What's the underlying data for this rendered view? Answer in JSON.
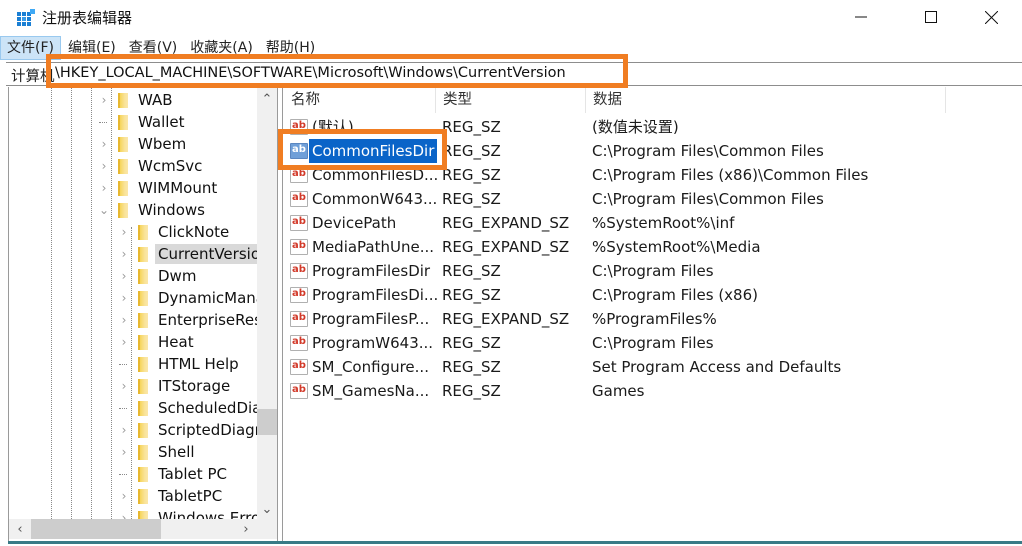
{
  "window": {
    "title": "注册表编辑器",
    "app_icon": "regedit-icon",
    "controls": {
      "minimize": "minimize-icon",
      "maximize": "maximize-icon",
      "close": "close-icon"
    }
  },
  "menu": {
    "items": [
      {
        "label": "文件(F)",
        "active": true
      },
      {
        "label": "编辑(E)",
        "active": false
      },
      {
        "label": "查看(V)",
        "active": false
      },
      {
        "label": "收藏夹(A)",
        "active": false
      },
      {
        "label": "帮助(H)",
        "active": false
      }
    ]
  },
  "address": {
    "prefix": "计算机",
    "path": "\\HKEY_LOCAL_MACHINE\\SOFTWARE\\Microsoft\\Windows\\CurrentVersion"
  },
  "annotation": {
    "color": "#f07d22"
  },
  "tree": {
    "items": [
      {
        "label": "WAB",
        "level": 0,
        "expander": "collapsed"
      },
      {
        "label": "Wallet",
        "level": 0,
        "expander": "none"
      },
      {
        "label": "Wbem",
        "level": 0,
        "expander": "collapsed"
      },
      {
        "label": "WcmSvc",
        "level": 0,
        "expander": "collapsed"
      },
      {
        "label": "WIMMount",
        "level": 0,
        "expander": "collapsed"
      },
      {
        "label": "Windows",
        "level": 0,
        "expander": "expanded"
      },
      {
        "label": "ClickNote",
        "level": 1,
        "expander": "collapsed"
      },
      {
        "label": "CurrentVersion",
        "level": 1,
        "expander": "collapsed",
        "selected": true
      },
      {
        "label": "Dwm",
        "level": 1,
        "expander": "collapsed"
      },
      {
        "label": "DynamicManagement",
        "level": 1,
        "expander": "collapsed"
      },
      {
        "label": "EnterpriseResourceManager",
        "level": 1,
        "expander": "collapsed"
      },
      {
        "label": "Heat",
        "level": 1,
        "expander": "collapsed"
      },
      {
        "label": "HTML Help",
        "level": 1,
        "expander": "none"
      },
      {
        "label": "ITStorage",
        "level": 1,
        "expander": "collapsed"
      },
      {
        "label": "ScheduledDiagnostics",
        "level": 1,
        "expander": "none"
      },
      {
        "label": "ScriptedDiagnosticsProvider",
        "level": 1,
        "expander": "collapsed"
      },
      {
        "label": "Shell",
        "level": 1,
        "expander": "collapsed"
      },
      {
        "label": "Tablet PC",
        "level": 1,
        "expander": "none"
      },
      {
        "label": "TabletPC",
        "level": 1,
        "expander": "collapsed"
      },
      {
        "label": "Windows Error Reporting",
        "level": 1,
        "expander": "collapsed"
      }
    ]
  },
  "list": {
    "columns": [
      "名称",
      "类型",
      "数据"
    ],
    "rows": [
      {
        "name": "(默认)",
        "type": "REG_SZ",
        "data": "(数值未设置)"
      },
      {
        "name": "CommonFilesDir",
        "type": "REG_SZ",
        "data": "C:\\Program Files\\Common Files",
        "selected": true
      },
      {
        "name": "CommonFilesD...",
        "type": "REG_SZ",
        "data": "C:\\Program Files (x86)\\Common Files"
      },
      {
        "name": "CommonW643...",
        "type": "REG_SZ",
        "data": "C:\\Program Files\\Common Files"
      },
      {
        "name": "DevicePath",
        "type": "REG_EXPAND_SZ",
        "data": "%SystemRoot%\\inf"
      },
      {
        "name": "MediaPathUne...",
        "type": "REG_EXPAND_SZ",
        "data": "%SystemRoot%\\Media"
      },
      {
        "name": "ProgramFilesDir",
        "type": "REG_SZ",
        "data": "C:\\Program Files"
      },
      {
        "name": "ProgramFilesDi...",
        "type": "REG_SZ",
        "data": "C:\\Program Files (x86)"
      },
      {
        "name": "ProgramFilesP...",
        "type": "REG_EXPAND_SZ",
        "data": "%ProgramFiles%"
      },
      {
        "name": "ProgramW643...",
        "type": "REG_SZ",
        "data": "C:\\Program Files"
      },
      {
        "name": "SM_Configure...",
        "type": "REG_SZ",
        "data": "Set Program Access and Defaults"
      },
      {
        "name": "SM_GamesNa...",
        "type": "REG_SZ",
        "data": "Games"
      }
    ]
  },
  "glyphs": {
    "chev_right": "›",
    "chev_down": "⌄",
    "scroll_up": "⌃",
    "scroll_down": "⌄",
    "scroll_left": "‹",
    "scroll_right": "›",
    "ab": "ab"
  }
}
